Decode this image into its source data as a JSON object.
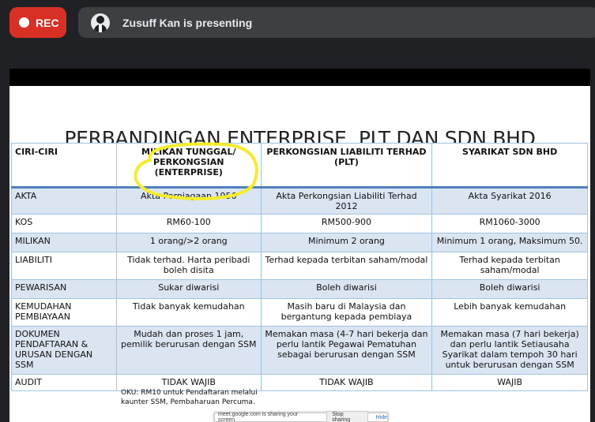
{
  "meeting": {
    "rec_label": "REC",
    "presenter_text": "Zusuff Kan is presenting"
  },
  "slide": {
    "title": "PERBANDINGAN ENTERPRISE, PLT DAN SDN BHD",
    "headers": [
      "CIRI-CIRI",
      "MILIKAN TUNGGAL/ PERKONGSIAN (ENTERPRISE)",
      "PERKONGSIAN LIABILITI TERHAD (PLT)",
      "SYARIKAT SDN BHD"
    ],
    "rows": [
      [
        "AKTA",
        "Akta Perniagaan 1956",
        "Akta Perkongsian Liabiliti Terhad 2012",
        "Akta Syarikat 2016"
      ],
      [
        "KOS",
        "RM60-100",
        "RM500-900",
        "RM1060-3000"
      ],
      [
        "MILIKAN",
        "1 orang/>2 orang",
        "Minimum 2 orang",
        "Minimum 1 orang, Maksimum 50."
      ],
      [
        "LIABILITI",
        "Tidak terhad. Harta peribadi boleh disita",
        "Terhad kepada terbitan saham/modal",
        "Terhad kepada terbitan saham/modal"
      ],
      [
        "PEWARISAN",
        "Sukar diwarisi",
        "Boleh diwarisi",
        "Boleh diwarisi"
      ],
      [
        "KEMUDAHAN PEMBIAYAAN",
        "Tidak banyak kemudahan",
        "Masih baru di Malaysia dan bergantung kepada pembiaya",
        "Lebih banyak kemudahan"
      ],
      [
        "DOKUMEN PENDAFTARAN & URUSAN DENGAN SSM",
        "Mudah dan proses 1 jam, pemilik berurusan dengan SSM",
        "Memakan masa (4-7 hari bekerja dan perlu lantik Pegawai Pematuhan sebagai berurusan dengan SSM",
        "Memakan masa (7 hari bekerja) dan perlu lantik Setiausaha Syarikat dalam tempoh 30 hari untuk berurusan dengan SSM"
      ],
      [
        "AUDIT",
        "TIDAK WAJIB",
        "TIDAK WAJIB",
        "WAJIB"
      ]
    ],
    "note": "OKU: RM10 untuk Pendaftaran melalui kaunter SSM, Pembaharuan Percuma."
  },
  "share_notice": {
    "text": "meet.google.com is sharing your screen.",
    "stop_label": "Stop sharing",
    "hide_label": "Hide"
  },
  "colors": {
    "rec": "#d93025",
    "bar": "#3c4043",
    "row_shade": "#dbe5f1",
    "header_rule": "#4f81bd",
    "highlight": "#f5ec2a"
  },
  "icons": [
    "record-dot-icon",
    "presenter-avatar"
  ]
}
